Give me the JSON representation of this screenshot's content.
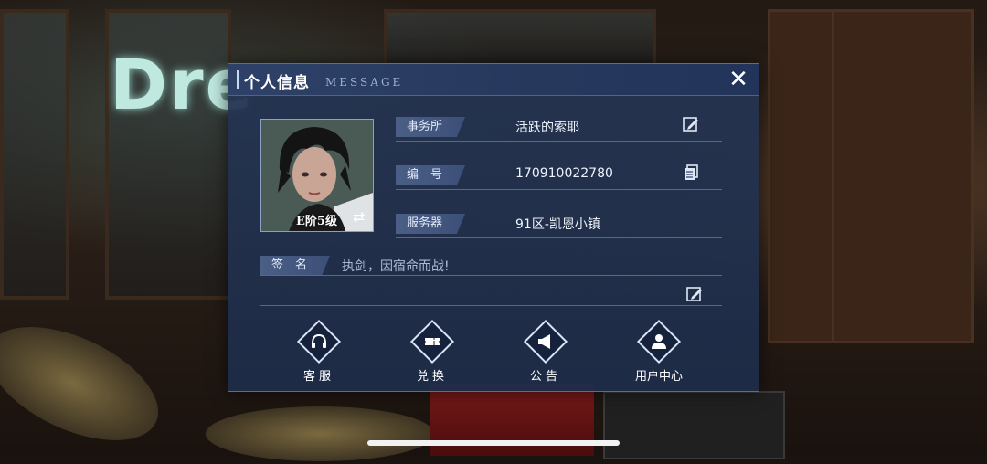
{
  "background": {
    "neon_sign": "Dre"
  },
  "dialog": {
    "title": "个人信息",
    "subtitle": "MESSAGE",
    "avatar": {
      "rank": "E阶5级"
    },
    "fields": [
      {
        "label": "事务所",
        "value": "活跃的索耶",
        "action_icon": "edit-icon"
      },
      {
        "label": "编　号",
        "value": "170910022780",
        "action_icon": "copy-icon"
      },
      {
        "label": "服务器",
        "value": "91区-凯恩小镇",
        "action_icon": ""
      }
    ],
    "signature": {
      "label": "签　名",
      "value": "执剑，因宿命而战!"
    },
    "menu": [
      {
        "label": "客服",
        "icon": "headset-icon"
      },
      {
        "label": "兑换",
        "icon": "ticket-icon"
      },
      {
        "label": "公告",
        "icon": "megaphone-icon"
      },
      {
        "label": "用户中心",
        "icon": "user-icon"
      }
    ]
  },
  "colors": {
    "dialog_bg": "#243452",
    "label_bg": "#4b5f86",
    "text": "#ffffff"
  }
}
